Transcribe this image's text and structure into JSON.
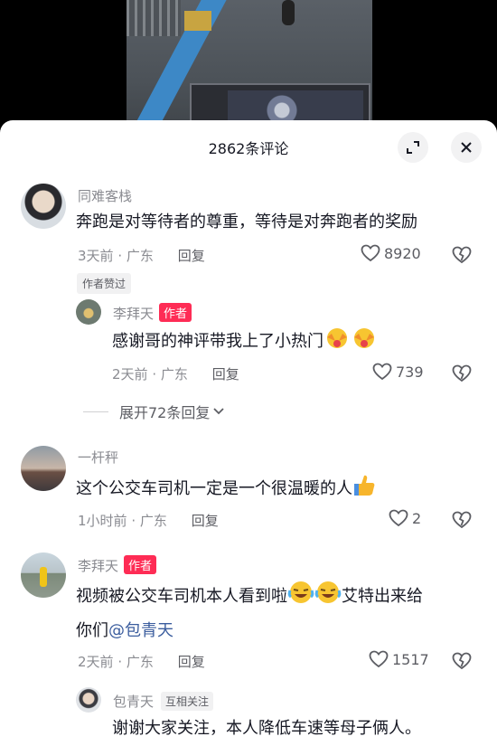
{
  "sheet": {
    "title": "2862条评论"
  },
  "comments": [
    {
      "user": "同难客栈",
      "text": "奔跑是对等待者的尊重，等待是对奔跑者的奖励",
      "time": "3天前",
      "region": "广东",
      "reply": "回复",
      "likes": "8920",
      "author_liked": "作者赞过",
      "sub_reply": {
        "user": "李拜天",
        "badge": "作者",
        "text": "感谢哥的神评带我上了小热门",
        "time": "2天前",
        "region": "广东",
        "reply": "回复",
        "likes": "739"
      },
      "expand": "展开72条回复"
    },
    {
      "user": "一杆秤",
      "text": "这个公交车司机一定是一个很温暖的人",
      "time": "1小时前",
      "region": "广东",
      "reply": "回复",
      "likes": "2"
    },
    {
      "user": "李拜天",
      "badge": "作者",
      "text_line1": "视频被公交车司机本人看到啦",
      "text_line1_tail": "艾特出来给",
      "text_line2": "你们",
      "mention": "@包青天",
      "time": "2天前",
      "region": "广东",
      "reply": "回复",
      "likes": "1517",
      "sub_reply": {
        "user": "包青天",
        "badge": "互相关注",
        "text": "谢谢大家关注，本人降低车速等母子俩人。"
      }
    }
  ],
  "separator": "·",
  "icons": [
    "expand-icon",
    "close-icon",
    "heart-icon",
    "dislike-heart-icon",
    "chevron-down-icon"
  ],
  "colors": {
    "author_badge": "#fe2c55",
    "muted": "#8a8b91",
    "mention": "#3b5d9e"
  }
}
